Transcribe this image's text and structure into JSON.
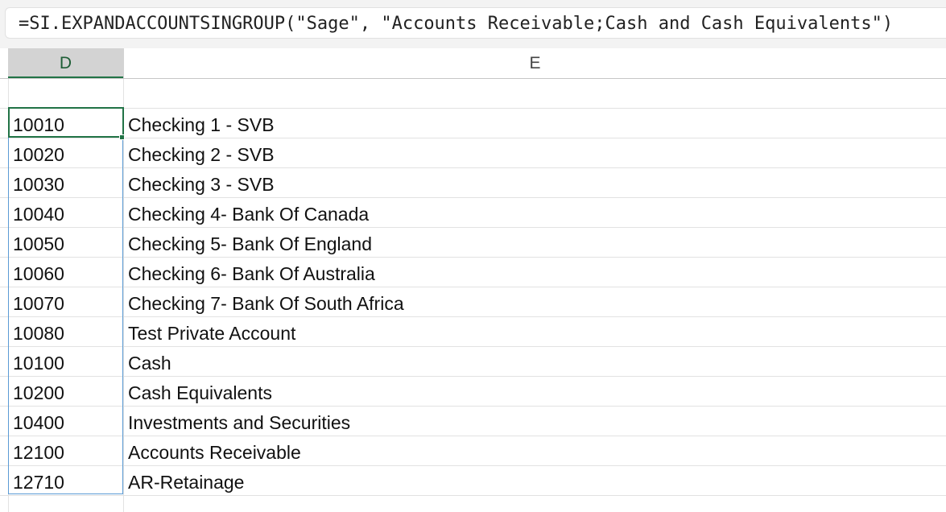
{
  "formula_bar": {
    "text": "=SI.EXPANDACCOUNTSINGROUP(\"Sage\", \"Accounts Receivable;Cash and Cash Equivalents\")"
  },
  "columns": {
    "d": "D",
    "e": "E"
  },
  "rows": [
    {
      "account": "10010",
      "name": "Checking 1 - SVB"
    },
    {
      "account": "10020",
      "name": "Checking 2 - SVB"
    },
    {
      "account": "10030",
      "name": "Checking 3 - SVB"
    },
    {
      "account": "10040",
      "name": "Checking 4- Bank Of Canada"
    },
    {
      "account": "10050",
      "name": "Checking 5- Bank Of England"
    },
    {
      "account": "10060",
      "name": "Checking 6- Bank Of Australia"
    },
    {
      "account": "10070",
      "name": "Checking 7- Bank Of South Africa"
    },
    {
      "account": "10080",
      "name": "Test Private Account"
    },
    {
      "account": "10100",
      "name": "Cash"
    },
    {
      "account": "10200",
      "name": "Cash Equivalents"
    },
    {
      "account": "10400",
      "name": "Investments and Securities"
    },
    {
      "account": "12100",
      "name": "Accounts Receivable"
    },
    {
      "account": "12710",
      "name": "AR-Retainage"
    }
  ],
  "colors": {
    "selection_accent": "#217346",
    "range_border": "#5b9bd5"
  }
}
